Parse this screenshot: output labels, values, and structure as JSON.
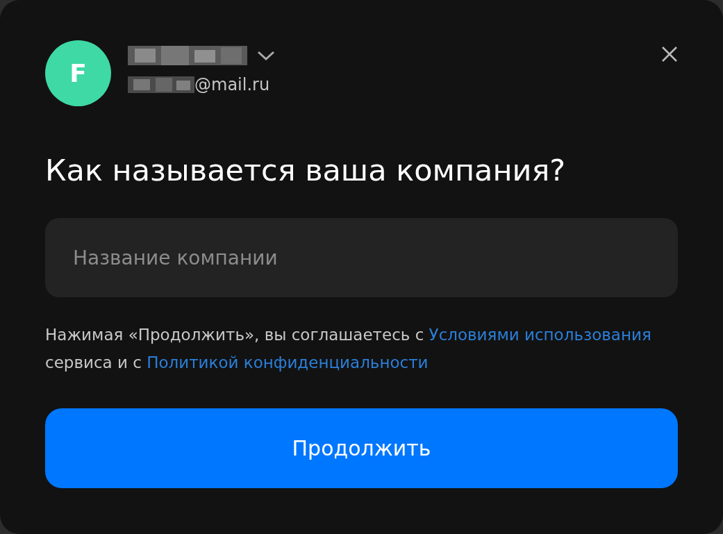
{
  "account": {
    "avatar_letter": "F",
    "email_visible": "@mail.ru"
  },
  "heading": "Как называется ваша компания?",
  "company_field": {
    "placeholder": "Название компании"
  },
  "agreement": [
    {
      "kind": "text",
      "text": "Нажимая «Продолжить», вы соглашаетесь с "
    },
    {
      "kind": "link",
      "text": "Условиями использования"
    },
    {
      "kind": "text",
      "text": " сервиса и с "
    },
    {
      "kind": "link",
      "text": "Политикой конфиденциальности"
    }
  ],
  "button": "Продолжить"
}
